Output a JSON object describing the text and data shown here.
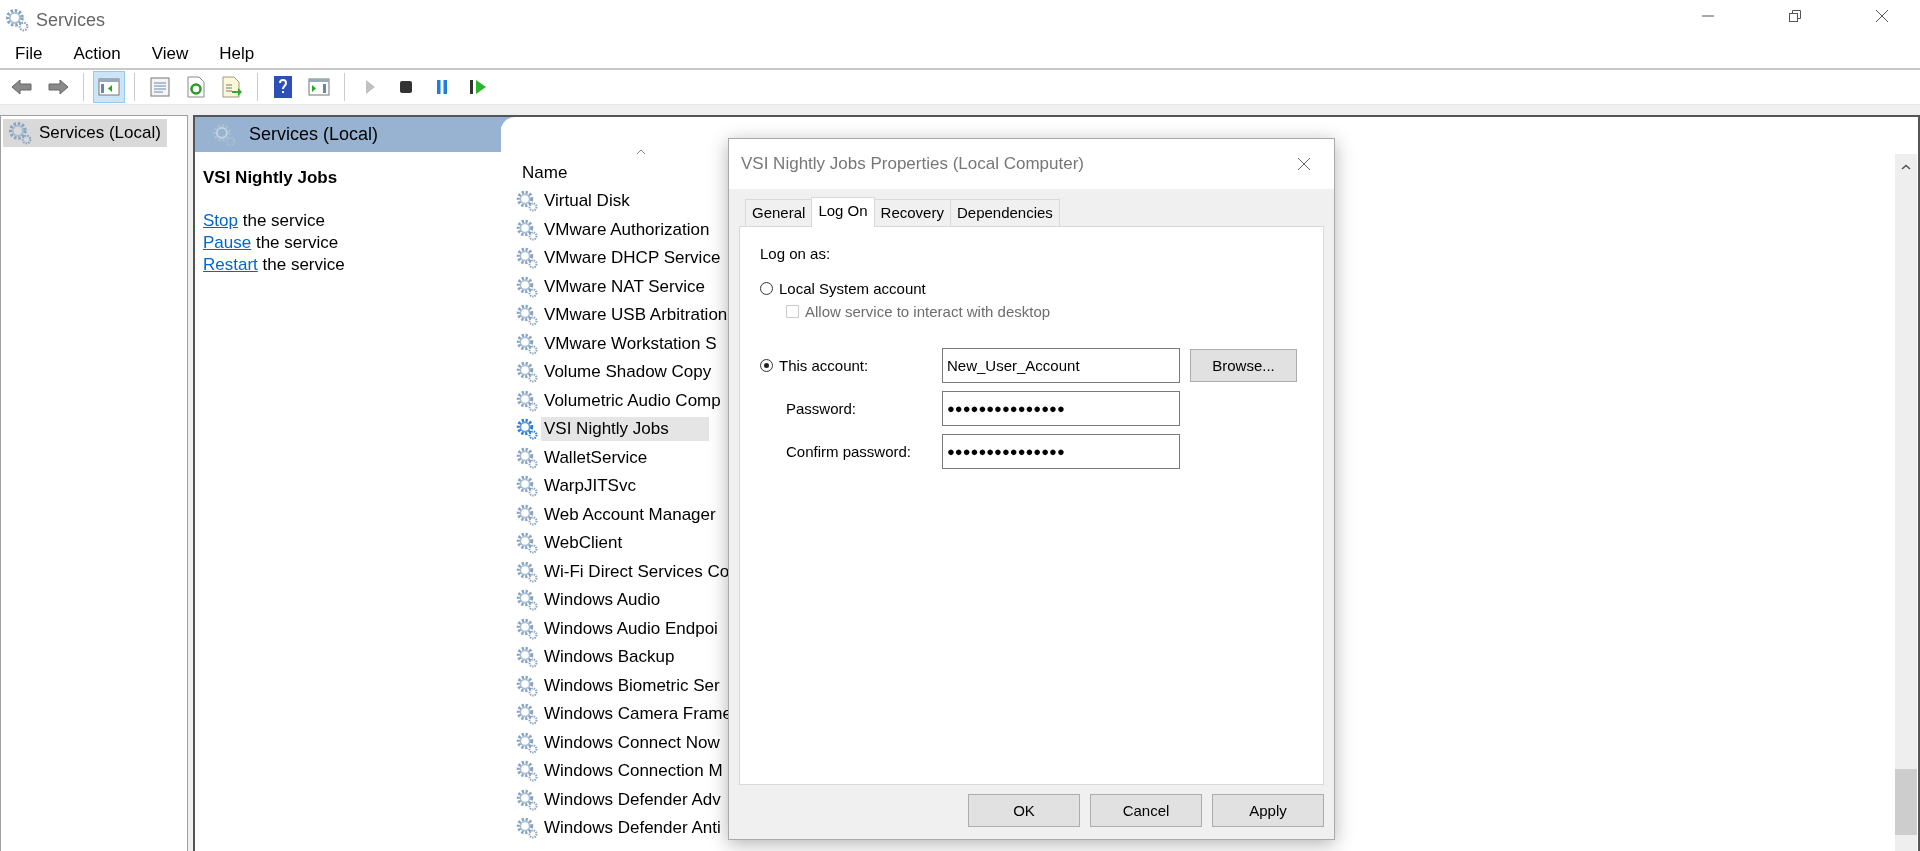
{
  "window": {
    "title": "Services"
  },
  "menu": [
    "File",
    "Action",
    "View",
    "Help"
  ],
  "toolbar": [
    {
      "kind": "back",
      "pressed": false,
      "disabled": false
    },
    {
      "kind": "forward",
      "pressed": false,
      "disabled": false
    },
    {
      "kind": "sep"
    },
    {
      "kind": "tree",
      "pressed": true,
      "disabled": false
    },
    {
      "kind": "sep"
    },
    {
      "kind": "properties",
      "pressed": false,
      "disabled": false
    },
    {
      "kind": "refresh",
      "pressed": false,
      "disabled": false
    },
    {
      "kind": "export",
      "pressed": false,
      "disabled": false
    },
    {
      "kind": "sep"
    },
    {
      "kind": "help",
      "pressed": false,
      "disabled": false
    },
    {
      "kind": "actionpane",
      "pressed": false,
      "disabled": false
    },
    {
      "kind": "sep"
    },
    {
      "kind": "play",
      "pressed": false,
      "disabled": true
    },
    {
      "kind": "stop",
      "pressed": false,
      "disabled": false
    },
    {
      "kind": "pause",
      "pressed": false,
      "disabled": false
    },
    {
      "kind": "resume",
      "pressed": false,
      "disabled": false
    }
  ],
  "tree": {
    "items": [
      {
        "label": "Services (Local)",
        "selected": true
      }
    ]
  },
  "pane_header": "Services (Local)",
  "description": {
    "title": "VSI Nightly Jobs",
    "actions": [
      {
        "link": "Stop",
        "text": "the service"
      },
      {
        "link": "Pause",
        "text": "the service"
      },
      {
        "link": "Restart",
        "text": "the service"
      }
    ]
  },
  "list": {
    "columns": [
      "Name"
    ],
    "rows": [
      {
        "name": "Virtual Disk",
        "selected": false
      },
      {
        "name": "VMware Authorization",
        "selected": false
      },
      {
        "name": "VMware DHCP Service",
        "selected": false
      },
      {
        "name": "VMware NAT Service",
        "selected": false
      },
      {
        "name": "VMware USB Arbitration",
        "selected": false
      },
      {
        "name": "VMware Workstation S",
        "selected": false
      },
      {
        "name": "Volume Shadow Copy",
        "selected": false
      },
      {
        "name": "Volumetric Audio Comp",
        "selected": false
      },
      {
        "name": "VSI Nightly Jobs",
        "selected": true
      },
      {
        "name": "WalletService",
        "selected": false
      },
      {
        "name": "WarpJITSvc",
        "selected": false
      },
      {
        "name": "Web Account Manager",
        "selected": false
      },
      {
        "name": "WebClient",
        "selected": false
      },
      {
        "name": "Wi-Fi Direct Services Co",
        "selected": false
      },
      {
        "name": "Windows Audio",
        "selected": false
      },
      {
        "name": "Windows Audio Endpoi",
        "selected": false
      },
      {
        "name": "Windows Backup",
        "selected": false
      },
      {
        "name": "Windows Biometric Ser",
        "selected": false
      },
      {
        "name": "Windows Camera Frame",
        "selected": false
      },
      {
        "name": "Windows Connect Now",
        "selected": false
      },
      {
        "name": "Windows Connection M",
        "selected": false
      },
      {
        "name": "Windows Defender Adv",
        "selected": false
      },
      {
        "name": "Windows Defender Anti",
        "selected": false
      }
    ]
  },
  "dialog": {
    "title": "VSI Nightly Jobs Properties (Local Computer)",
    "tabs": [
      {
        "label": "General",
        "selected": false
      },
      {
        "label": "Log On",
        "selected": true
      },
      {
        "label": "Recovery",
        "selected": false
      },
      {
        "label": "Dependencies",
        "selected": false
      }
    ],
    "log_on_as": "Log on as:",
    "local_system": {
      "label": "Local System account",
      "checked": false
    },
    "interact": {
      "label": "Allow service to interact with desktop",
      "checked": false,
      "disabled": true
    },
    "this_account": {
      "label": "This account:",
      "checked": true,
      "value": "New_User_Account",
      "browse": "Browse..."
    },
    "password": {
      "label": "Password:",
      "value": "●●●●●●●●●●●●●●●"
    },
    "confirm": {
      "label": "Confirm password:",
      "value": "●●●●●●●●●●●●●●●"
    },
    "buttons": [
      "OK",
      "Cancel",
      "Apply"
    ]
  }
}
